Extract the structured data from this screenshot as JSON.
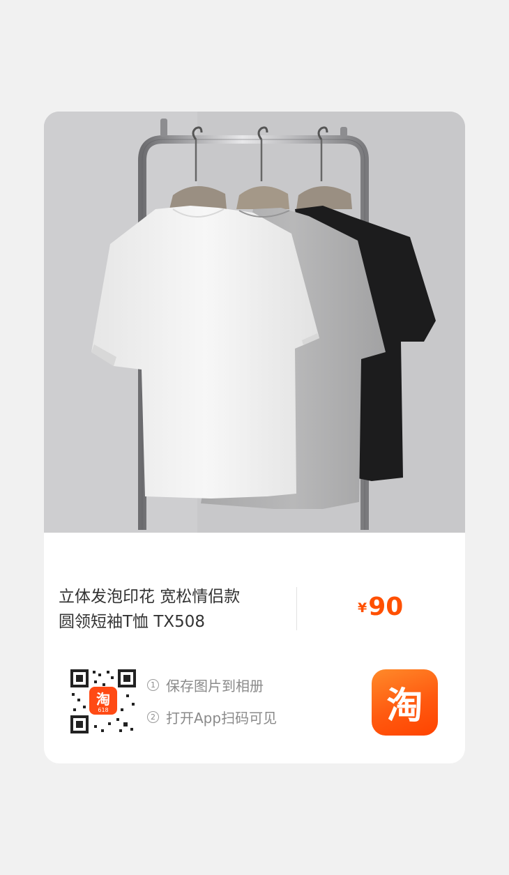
{
  "product": {
    "title_line1": "立体发泡印花 宽松情侣款",
    "title_line2": "圆领短袖T恤 TX508",
    "price_symbol": "¥",
    "price_value": "90"
  },
  "instructions": {
    "step1_number": "1",
    "step1_text": "保存图片到相册",
    "step2_number": "2",
    "step2_text": "打开App扫码可见"
  },
  "qr": {
    "center_logo_char": "淘",
    "center_logo_sub": "618"
  },
  "app_icon": {
    "char": "淘"
  },
  "colors": {
    "price": "#ff5000",
    "brand_orange": "#ff5a10",
    "title_text": "#333333",
    "hint_text": "#8a8a8a"
  },
  "image": {
    "subject": "three t-shirts (white, grey, black) on a clothing rack",
    "icons": [
      "product-photo",
      "qr-code-icon",
      "taobao-app-icon"
    ]
  }
}
